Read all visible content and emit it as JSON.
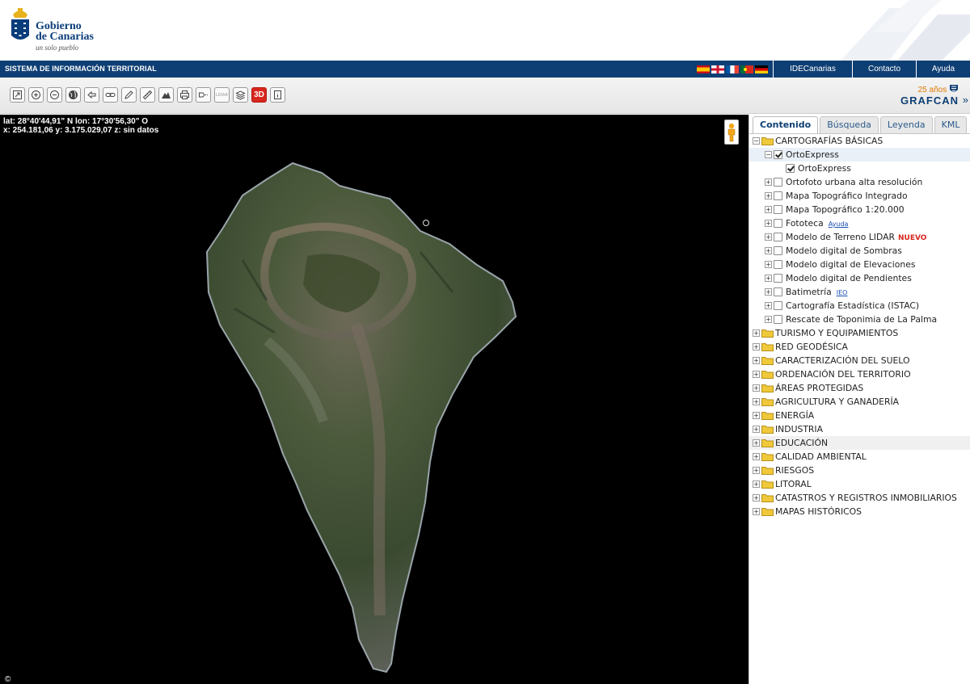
{
  "logo": {
    "line1": "Gobierno",
    "line2": "de Canarias",
    "slogan": "un solo pueblo"
  },
  "navbar": {
    "title": "SISTEMA DE INFORMACIÓN TERRITORIAL",
    "flags": [
      "es",
      "gb",
      "fr",
      "pt",
      "de"
    ],
    "links": [
      "IDECanarias",
      "Contacto",
      "Ayuda"
    ]
  },
  "toolbar": {
    "tools": [
      "full-extent",
      "zoom-in",
      "zoom-out",
      "pan",
      "previous-view",
      "link",
      "draw",
      "measure",
      "profile",
      "print",
      "export",
      "lidar",
      "layers",
      "3d",
      "info"
    ],
    "label_3d": "3D",
    "label_lidar": "LIDAR",
    "grafcan_anniversary": "25 años",
    "grafcan_name": "GRAFCAN",
    "expand": "»"
  },
  "map": {
    "coords_line1": "lat: 28°40'44,91\" N  lon: 17°30'56,30\" O",
    "coords_line2": "x: 254.181,06  y: 3.175.029,07  z: sin datos",
    "credit": "©"
  },
  "panel": {
    "tabs": [
      "Contenido",
      "Búsqueda",
      "Leyenda",
      "KML"
    ],
    "active_tab": "Contenido",
    "tree": [
      {
        "label": "CARTOGRAFÍAS BÁSICAS",
        "level": 0,
        "type": "folder",
        "expanded": true
      },
      {
        "label": "OrtoExpress",
        "level": 1,
        "type": "layer",
        "checked": true,
        "expanded": true,
        "highlight": true
      },
      {
        "label": "OrtoExpress",
        "level": 2,
        "type": "layer",
        "checked": true,
        "leaf": true
      },
      {
        "label": "Ortofoto urbana alta resolución",
        "level": 1,
        "type": "layer",
        "checked": false
      },
      {
        "label": "Mapa Topográfico Integrado",
        "level": 1,
        "type": "layer",
        "checked": false
      },
      {
        "label": "Mapa Topográfico 1:20.000",
        "level": 1,
        "type": "layer",
        "checked": false
      },
      {
        "label": "Fototeca",
        "level": 1,
        "type": "layer",
        "checked": false,
        "link": "Ayuda"
      },
      {
        "label": "Modelo de Terreno LIDAR",
        "level": 1,
        "type": "layer",
        "checked": false,
        "badge": "NUEVO"
      },
      {
        "label": "Modelo digital de Sombras",
        "level": 1,
        "type": "layer",
        "checked": false
      },
      {
        "label": "Modelo digital de Elevaciones",
        "level": 1,
        "type": "layer",
        "checked": false
      },
      {
        "label": "Modelo digital de Pendientes",
        "level": 1,
        "type": "layer",
        "checked": false
      },
      {
        "label": "Batimetría",
        "level": 1,
        "type": "layer",
        "checked": false,
        "link": "IEO"
      },
      {
        "label": "Cartografía Estadística (ISTAC)",
        "level": 1,
        "type": "layer",
        "checked": false
      },
      {
        "label": "Rescate de Toponimia de La Palma",
        "level": 1,
        "type": "layer",
        "checked": false
      },
      {
        "label": "TURISMO Y EQUIPAMIENTOS",
        "level": 0,
        "type": "folder"
      },
      {
        "label": "RED GEODÉSICA",
        "level": 0,
        "type": "folder"
      },
      {
        "label": "CARACTERIZACIÓN DEL SUELO",
        "level": 0,
        "type": "folder"
      },
      {
        "label": "ORDENACIÓN DEL TERRITORIO",
        "level": 0,
        "type": "folder"
      },
      {
        "label": "ÁREAS PROTEGIDAS",
        "level": 0,
        "type": "folder"
      },
      {
        "label": "AGRICULTURA Y GANADERÍA",
        "level": 0,
        "type": "folder"
      },
      {
        "label": "ENERGÍA",
        "level": 0,
        "type": "folder"
      },
      {
        "label": "INDUSTRIA",
        "level": 0,
        "type": "folder"
      },
      {
        "label": "EDUCACIÓN",
        "level": 0,
        "type": "folder",
        "band": true
      },
      {
        "label": "CALIDAD AMBIENTAL",
        "level": 0,
        "type": "folder"
      },
      {
        "label": "RIESGOS",
        "level": 0,
        "type": "folder"
      },
      {
        "label": "LITORAL",
        "level": 0,
        "type": "folder"
      },
      {
        "label": "CATASTROS Y REGISTROS INMOBILIARIOS",
        "level": 0,
        "type": "folder"
      },
      {
        "label": "MAPAS HISTÓRICOS",
        "level": 0,
        "type": "folder"
      }
    ]
  },
  "colors": {
    "navy": "#0e3f74",
    "orange": "#e07b00",
    "red": "#d7261e",
    "folder": "#f0c93a"
  }
}
